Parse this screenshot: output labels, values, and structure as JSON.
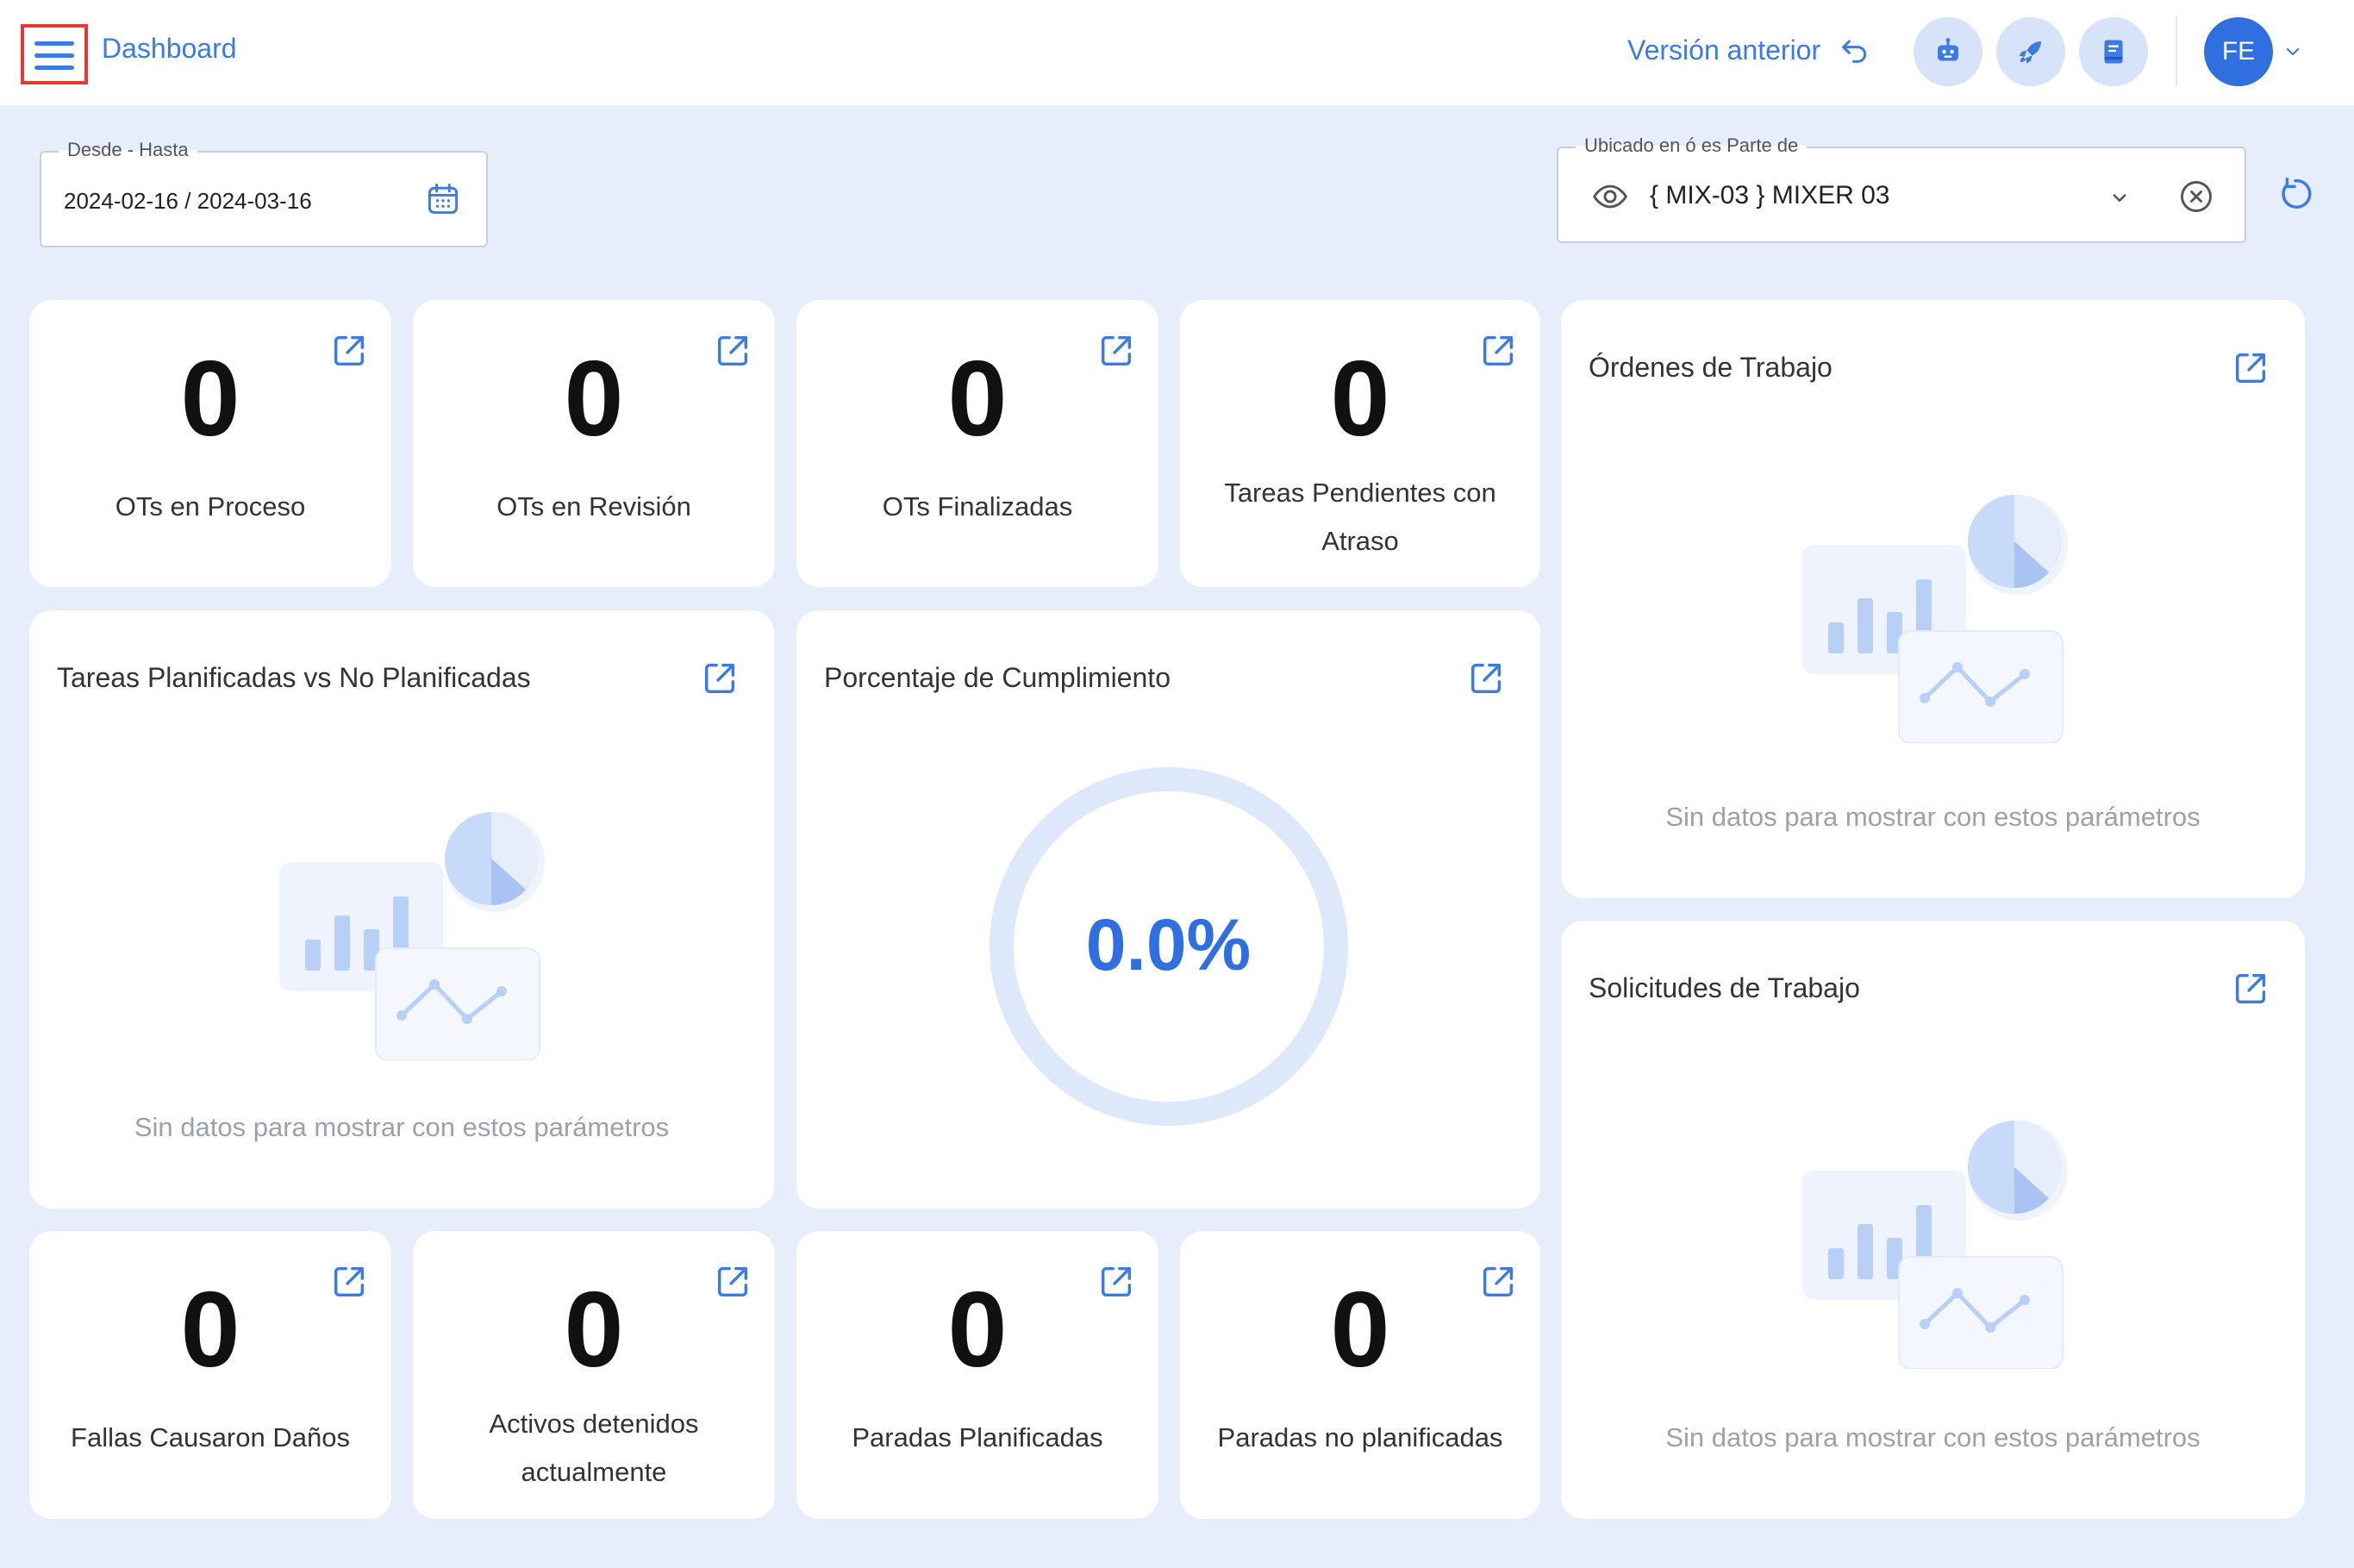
{
  "header": {
    "title": "Dashboard",
    "previous_version_label": "Versión anterior",
    "avatar_initials": "FE"
  },
  "filters": {
    "date_range": {
      "label": "Desde - Hasta",
      "value": "2024-02-16 / 2024-03-16"
    },
    "location": {
      "label": "Ubicado en ó es Parte de",
      "value": "{ MIX-03 } MIXER 03"
    }
  },
  "stats_top": [
    {
      "value": "0",
      "label": "OTs en Proceso"
    },
    {
      "value": "0",
      "label": "OTs en Revisión"
    },
    {
      "value": "0",
      "label": "OTs Finalizadas"
    },
    {
      "value": "0",
      "label": "Tareas Pendientes con Atraso"
    }
  ],
  "stats_bottom": [
    {
      "value": "0",
      "label": "Fallas Causaron Daños"
    },
    {
      "value": "0",
      "label": "Activos detenidos actualmente"
    },
    {
      "value": "0",
      "label": "Paradas Planificadas"
    },
    {
      "value": "0",
      "label": "Paradas no planificadas"
    }
  ],
  "panels": {
    "planned_tasks": {
      "title": "Tareas Planificadas vs No Planificadas",
      "empty_message": "Sin datos para mostrar con estos parámetros"
    },
    "compliance": {
      "title": "Porcentaje de Cumplimiento",
      "value": "0.0%"
    },
    "work_orders": {
      "title": "Órdenes de Trabajo",
      "empty_message": "Sin datos para mostrar con estos parámetros"
    },
    "work_requests": {
      "title": "Solicitudes de Trabajo",
      "empty_message": "Sin datos para mostrar con estos parámetros"
    }
  },
  "icons": {
    "menu": "hamburger-menu-icon",
    "previous_version": "undo-arrow-icon",
    "bot": "robot-icon",
    "rocket": "rocket-icon",
    "docs": "document-icon",
    "calendar": "calendar-icon",
    "eye": "eye-icon",
    "clear": "clear-circle-icon",
    "refresh": "refresh-icon",
    "external_link": "external-link-icon"
  },
  "colors": {
    "accent": "#3b7be3",
    "background": "#e6eefc",
    "card": "#ffffff",
    "highlight_border": "#e53935"
  }
}
